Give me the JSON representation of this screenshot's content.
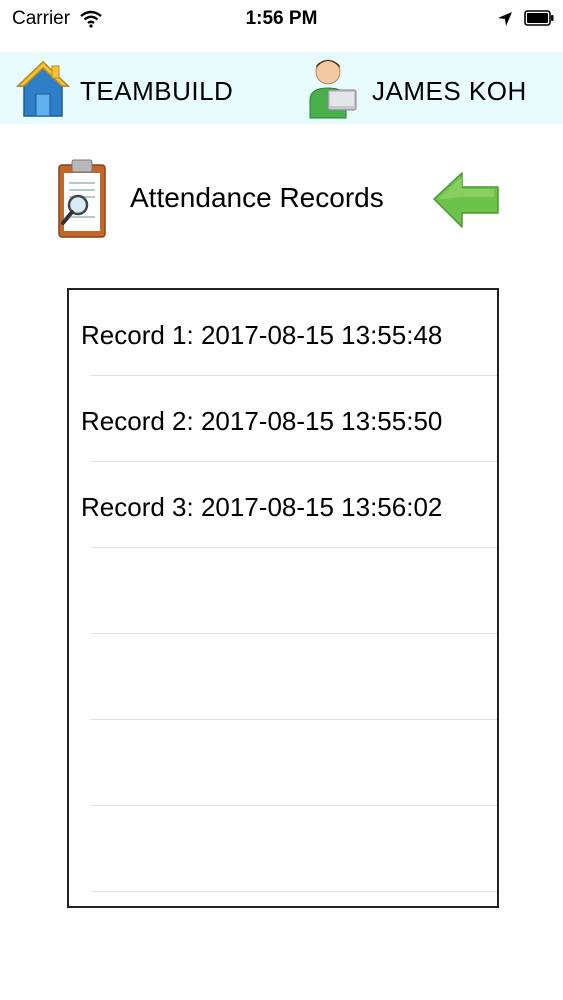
{
  "status": {
    "carrier": "Carrier",
    "time": "1:56 PM"
  },
  "header": {
    "team_label": "TEAMBUILD",
    "user_label": "JAMES KOH"
  },
  "page": {
    "title": "Attendance Records"
  },
  "records": [
    "Record 1: 2017-08-15 13:55:48",
    "Record 2: 2017-08-15 13:55:50",
    "Record 3: 2017-08-15 13:56:02",
    "",
    "",
    "",
    ""
  ],
  "colors": {
    "header_bg": "#e8fbfd",
    "back_arrow": "#6cc24a",
    "border": "#222222"
  },
  "icons": [
    "wifi-icon",
    "location-icon",
    "battery-icon",
    "home-icon",
    "user-icon",
    "clipboard-icon",
    "back-arrow-icon"
  ]
}
